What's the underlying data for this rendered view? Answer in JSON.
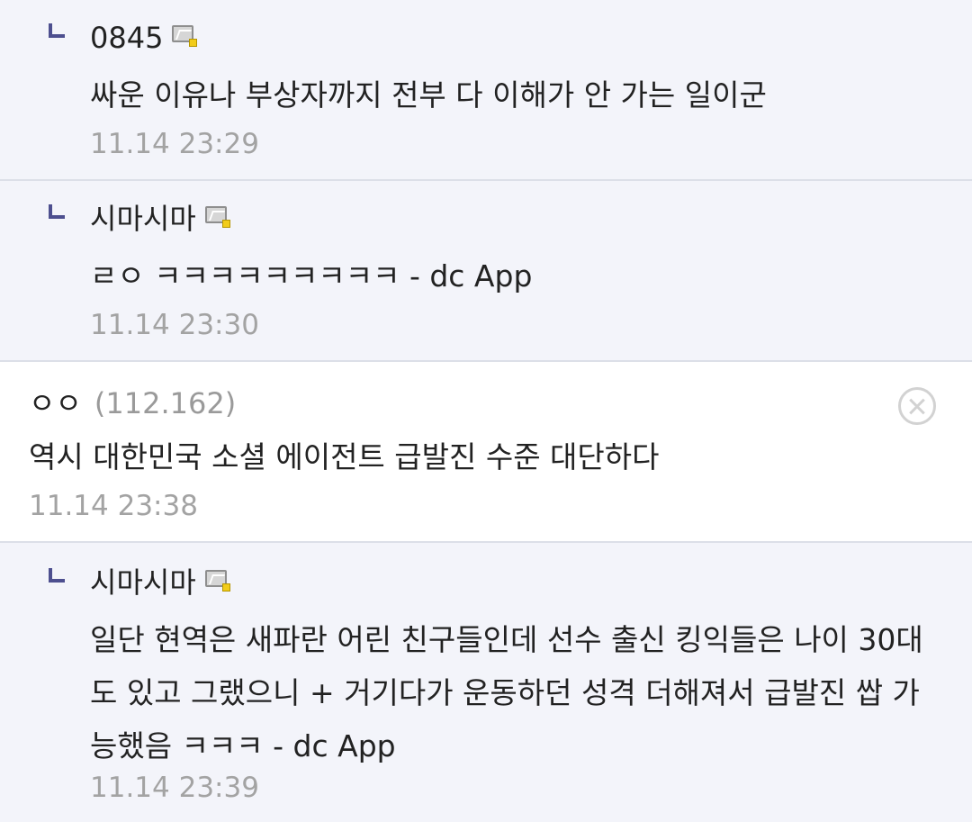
{
  "comments": [
    {
      "nickname": "0845",
      "text": "싸운 이유나 부상자까지 전부 다 이해가 안 가는 일이군",
      "time": "11.14 23:29"
    },
    {
      "nickname": "시마시마",
      "text": "ㄹㅇ ㅋㅋㅋㅋㅋㅋㅋㅋㅋ - dc App",
      "time": "11.14 23:30"
    },
    {
      "nickname": "ㅇㅇ",
      "ip": "(112.162)",
      "text": "역시 대한민국 소셜 에이전트 급발진 수준 대단하다",
      "time": "11.14 23:38"
    },
    {
      "nickname": "시마시마",
      "text": "일단 현역은 새파란 어린 친구들인데 선수 출신 킹익들은 나이 30대도 있고 그랬으니 + 거기다가 운동하던 성격 더해져서 급발진 쌉 가능했음 ㅋㅋㅋ - dc App",
      "time": "11.14 23:39"
    }
  ]
}
